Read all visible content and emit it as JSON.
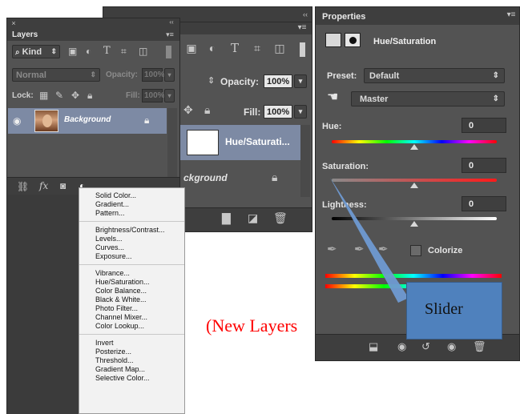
{
  "layers_panel": {
    "tab": "Layers",
    "filter": "Kind",
    "blend_mode": "Normal",
    "opacity_label": "Opacity:",
    "opacity_value": "100%",
    "lock_label": "Lock:",
    "fill_label": "Fill:",
    "fill_value": "100%",
    "layer_name": "Background"
  },
  "layers_panel_2": {
    "opacity_label": "Opacity:",
    "opacity_value": "100%",
    "fill_label": "Fill:",
    "fill_value": "100%",
    "adjustment_layer": "Hue/Saturati...",
    "background_layer": "ckground"
  },
  "adjustment_menu": {
    "groups": [
      [
        "Solid Color...",
        "Gradient...",
        "Pattern..."
      ],
      [
        "Brightness/Contrast...",
        "Levels...",
        "Curves...",
        "Exposure..."
      ],
      [
        "Vibrance...",
        "Hue/Saturation...",
        "Color Balance...",
        "Black & White...",
        "Photo Filter...",
        "Channel Mixer...",
        "Color Lookup..."
      ],
      [
        "Invert",
        "Posterize...",
        "Threshold...",
        "Gradient Map...",
        "Selective Color..."
      ]
    ]
  },
  "properties_panel": {
    "tab": "Properties",
    "title": "Hue/Saturation",
    "preset_label": "Preset:",
    "preset_value": "Default",
    "channel_value": "Master",
    "hue_label": "Hue:",
    "hue_value": "0",
    "hue_level": 0.5,
    "saturation_label": "Saturation:",
    "saturation_value": "0",
    "saturation_level": 0.5,
    "lightness_label": "Lightness:",
    "lightness_value": "0",
    "lightness_level": 0.5,
    "colorize_label": "Colorize"
  },
  "annotations": {
    "callout_text": "Slider",
    "new_layers_text": "(New Layers"
  },
  "colors": {
    "panel_bg": "#535353",
    "callout_fill": "#4f81bd",
    "annotation_red": "#ff0000"
  }
}
